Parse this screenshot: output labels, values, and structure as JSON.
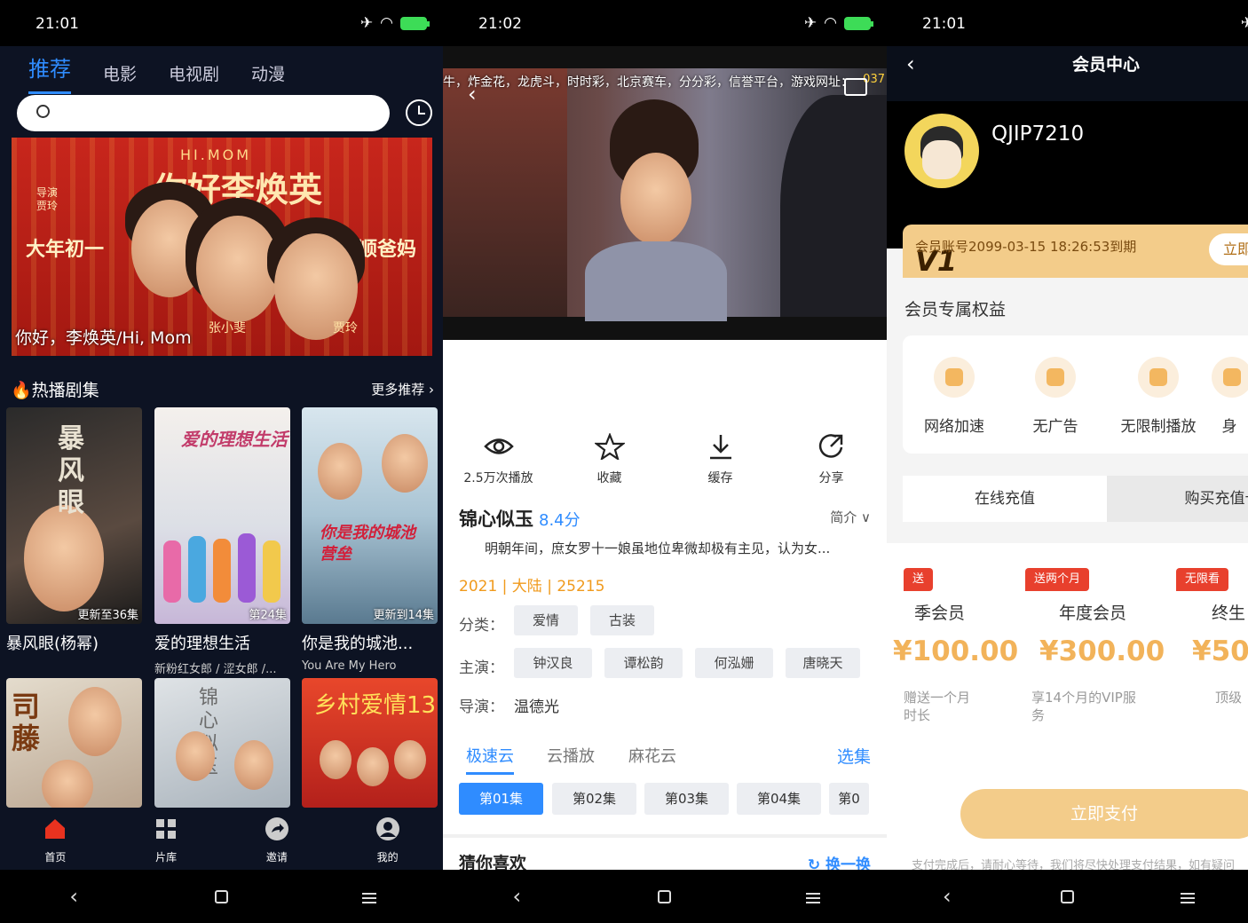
{
  "screen1": {
    "status": {
      "time": "21:01"
    },
    "tabs": [
      {
        "label": "推荐",
        "active": true
      },
      {
        "label": "电影"
      },
      {
        "label": "电视剧"
      },
      {
        "label": "动漫"
      }
    ],
    "banner": {
      "top_title": "HI.MOM",
      "title": "你好李焕英",
      "director": "导演\n贾玲",
      "left_text": "大年初一",
      "right_text": "笑顺爸妈",
      "name1": "张小斐",
      "name2": "贾玲",
      "caption": "你好，李焕英/Hi, Mom"
    },
    "section": {
      "title": "热播剧集",
      "more": "更多推荐"
    },
    "cards": [
      {
        "title": "暴风眼(杨幂)",
        "update": "更新至36集",
        "poster_text": "暴风眼",
        "subtitle": ""
      },
      {
        "title": "爱的理想生活",
        "update": "第24集",
        "poster_text": "爱的理想生活",
        "subtitle": "新粉红女郎 / 涩女郎 /..."
      },
      {
        "title": "你是我的城池...",
        "update": "更新到14集",
        "poster_text": "你是我的城池营垒",
        "subtitle": "You Are My Hero"
      }
    ],
    "row2": [
      {
        "poster_text": "司藤"
      },
      {
        "poster_text": "锦心似玉"
      },
      {
        "poster_text": "乡村爱情13"
      }
    ],
    "bottom_nav": [
      {
        "label": "首页",
        "icon": "home-icon",
        "active": true
      },
      {
        "label": "片库",
        "icon": "grid-icon"
      },
      {
        "label": "邀请",
        "icon": "share-arrow-icon"
      },
      {
        "label": "我的",
        "icon": "user-icon"
      }
    ]
  },
  "screen2": {
    "status": {
      "time": "21:02"
    },
    "marquee": "牛，炸金花，龙虎斗，时时彩，北京赛车，分分彩，信誉平台，游戏网址：",
    "marquee_num": "037",
    "actions": [
      {
        "label": "2.5万次播放",
        "icon": "eye-icon"
      },
      {
        "label": "收藏",
        "icon": "star-icon"
      },
      {
        "label": "缓存",
        "icon": "download-icon"
      },
      {
        "label": "分享",
        "icon": "share-icon"
      }
    ],
    "title": "锦心似玉",
    "score": "8.4分",
    "intro_label": "简介",
    "description": "明朝年间，庶女罗十一娘虽地位卑微却极有主见，认为女...",
    "meta": "2021 | 大陆 | 25215",
    "category_label": "分类：",
    "categories": [
      "爱情",
      "古装"
    ],
    "cast_label": "主演：",
    "cast": [
      "钟汉良",
      "谭松韵",
      "何泓姗",
      "唐晓天"
    ],
    "director_label": "导演：",
    "director": "温德光",
    "sources": [
      {
        "label": "极速云",
        "active": true
      },
      {
        "label": "云播放"
      },
      {
        "label": "麻花云"
      }
    ],
    "select_episodes": "选集",
    "episodes": [
      {
        "label": "第01集",
        "active": true
      },
      {
        "label": "第02集"
      },
      {
        "label": "第03集"
      },
      {
        "label": "第04集"
      },
      {
        "label": "第0"
      }
    ],
    "guess_title": "猜你喜欢",
    "swap_label": "换一换"
  },
  "screen3": {
    "status": {
      "time": "21:01"
    },
    "header_title": "会员中心",
    "username": "QJIP7210",
    "vip": {
      "badge": "V1",
      "expiry": "会员账号2099-03-15 18:26:53到期",
      "button": "立即"
    },
    "rights_title": "会员专属权益",
    "rights": [
      {
        "label": "网络加速"
      },
      {
        "label": "无广告"
      },
      {
        "label": "无限制播放"
      },
      {
        "label": "身"
      }
    ],
    "tabs": [
      {
        "label": "在线充值",
        "active": true
      },
      {
        "label": "购买充值卡"
      }
    ],
    "plans": [
      {
        "tag": "送",
        "name": "季会员",
        "price": "¥100.00",
        "desc": "赠送一个月\n时长"
      },
      {
        "tag": "送两个月",
        "name": "年度会员",
        "price": "¥300.00",
        "desc": "享14个月的VIP服\n务"
      },
      {
        "tag": "无限看",
        "name": "终生",
        "price": "¥50",
        "desc": "顶级"
      }
    ],
    "pay_button": "立即支付",
    "notice": "支付完成后，请耐心等待，我们将尽快处理支付结果，如有疑问"
  },
  "system_nav": [
    "back",
    "home",
    "recents"
  ],
  "colors": {
    "accent_blue": "#2f8cff",
    "gold": "#f3cc8a",
    "orange_text": "#f09a1c",
    "dark_bg": "#0d1323"
  }
}
